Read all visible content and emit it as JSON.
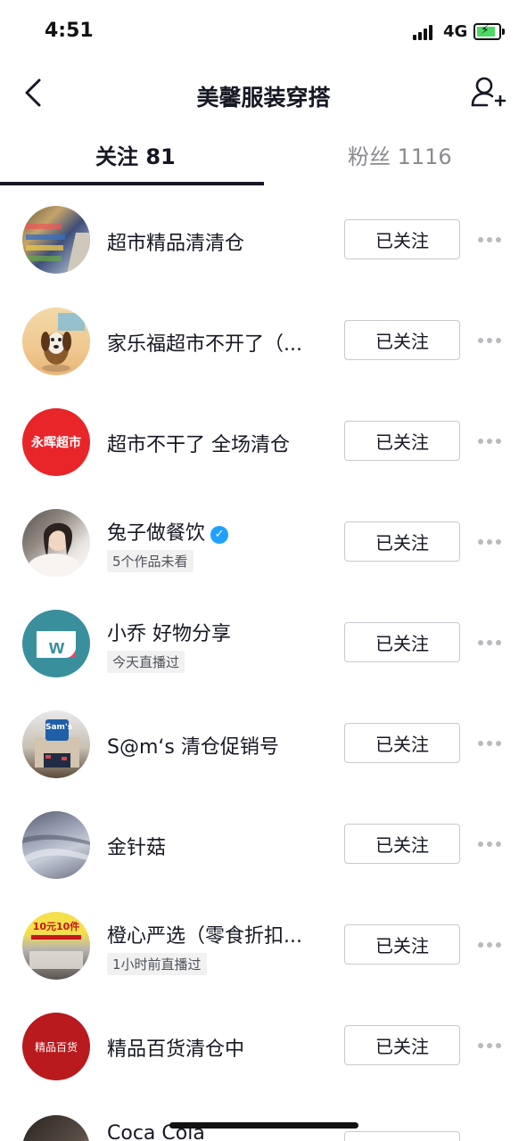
{
  "status_bar": {
    "time": "4:51",
    "network": "4G",
    "battery_color": "#4cd964"
  },
  "header": {
    "title": "美馨服装穿搭",
    "back_icon": "chevron-left-icon",
    "add_icon": "add-user-icon"
  },
  "tabs": {
    "following": "关注 81",
    "fans": "粉丝 1116"
  },
  "list": [
    {
      "name": "超市精品清清仓",
      "sub": "",
      "verified": false,
      "button": "已关注",
      "avatar": "photo-supermarket-shelves"
    },
    {
      "name": "家乐福超市不开了（...",
      "sub": "",
      "verified": false,
      "button": "已关注",
      "avatar": "photo-cartoon-dog"
    },
    {
      "name": "超市不干了 全场清仓",
      "sub": "",
      "verified": false,
      "button": "已关注",
      "avatar": "text-logo",
      "avatar_text": "永晖超市"
    },
    {
      "name": "兔子做餐饮",
      "sub": "5个作品未看",
      "verified": true,
      "button": "已关注",
      "avatar": "photo-woman"
    },
    {
      "name": "小乔 好物分享",
      "sub": "今天直播过",
      "verified": false,
      "button": "已关注",
      "avatar": "logo-w"
    },
    {
      "name": "S@m‘s 清仓促销号",
      "sub": "",
      "verified": false,
      "button": "已关注",
      "avatar": "photo-sams-store",
      "avatar_text": "Sam's"
    },
    {
      "name": "金针菇",
      "sub": "",
      "verified": false,
      "button": "已关注",
      "avatar": "abstract-gray"
    },
    {
      "name": "橙心严选（零食折扣...",
      "sub": "1小时前直播过",
      "verified": false,
      "button": "已关注",
      "avatar": "photo-store-banner",
      "avatar_text": "10元10件"
    },
    {
      "name": "精品百货清仓中",
      "sub": "",
      "verified": false,
      "button": "已关注",
      "avatar": "text-logo",
      "avatar_text": "精品百货"
    },
    {
      "name": "Coca Cola",
      "sub": "",
      "verified": false,
      "button": "",
      "avatar": "photo-dark"
    }
  ]
}
